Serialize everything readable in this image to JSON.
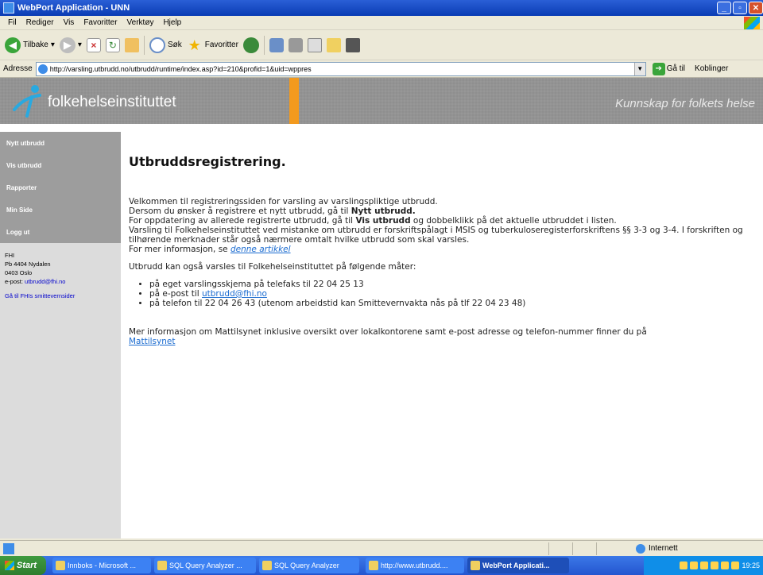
{
  "window": {
    "title": "WebPort Application - UNN"
  },
  "menu": [
    "Fil",
    "Rediger",
    "Vis",
    "Favoritter",
    "Verktøy",
    "Hjelp"
  ],
  "toolbar": {
    "back": "Tilbake",
    "search": "Søk",
    "favorites": "Favoritter"
  },
  "address": {
    "label": "Adresse",
    "url": "http://varsling.utbrudd.no/utbrudd/runtime/index.asp?id=210&profid=1&uid=wppres",
    "go": "Gå til",
    "links": "Koblinger"
  },
  "banner": {
    "logo": "folkehelseinstituttet",
    "tagline": "Kunnskap for folkets helse"
  },
  "nav": [
    {
      "label": "Nytt utbrudd"
    },
    {
      "label": "Vis utbrudd"
    },
    {
      "label": "Rapporter"
    },
    {
      "label": "Min Side"
    },
    {
      "label": "Logg ut"
    }
  ],
  "contact": {
    "org": "FHI",
    "address1": "Pb 4404 Nydalen",
    "address2": "0403 Oslo",
    "email_prefix": "e-post:",
    "email": "utbrudd@fhi.no",
    "link": "Gå til FHIs smittevernsider"
  },
  "main": {
    "heading": "Utbruddsregistrering.",
    "p1_line1": "Velkommen til registreringssiden for varsling av varslingspliktige utbrudd.",
    "p1_line2_pre": "Dersom du ønsker å registrere et nytt utbrudd, gå til ",
    "p1_line2_bold": "Nytt utbrudd.",
    "p1_line3_pre": "For oppdatering av allerede registrerte utbrudd, gå til ",
    "p1_line3_bold": "Vis utbrudd",
    "p1_line3_post": " og dobbelklikk på det aktuelle utbruddet i listen.",
    "p1_line4": "Varsling til Folkehelseinstituttet ved mistanke om utbrudd er forskriftspålagt i MSIS og tuberkuloseregisterforskriftens §§ 3-3 og 3-4. I forskriften og tilhørende merknader står også nærmere omtalt hvilke utbrudd som skal varsles.",
    "p1_line5_pre": "For mer informasjon, se ",
    "p1_line5_link": "denne artikkel",
    "p2": "Utbrudd kan også varsles til Folkehelseinstituttet på følgende måter:",
    "bullet1": "på eget varslingsskjema på telefaks til 22 04 25 13",
    "bullet2_pre": "på e-post til ",
    "bullet2_link": "utbrudd@fhi.no",
    "bullet3": "på telefon til 22 04 26 43 (utenom arbeidstid kan Smittevernvakta nås på tlf 22 04 23 48)",
    "p3": "Mer informasjon om Mattilsynet inklusive oversikt over lokalkontorene samt e-post adresse og telefon-nummer finner du på",
    "p3_link": "Mattilsynet"
  },
  "status": {
    "zone": "Internett"
  },
  "taskbar": {
    "start": "Start",
    "tasks": [
      "Innboks - Microsoft ...",
      "SQL Query Analyzer ...",
      "SQL Query Analyzer",
      "http://www.utbrudd....",
      "WebPort Applicati..."
    ],
    "clock": "19:25"
  }
}
